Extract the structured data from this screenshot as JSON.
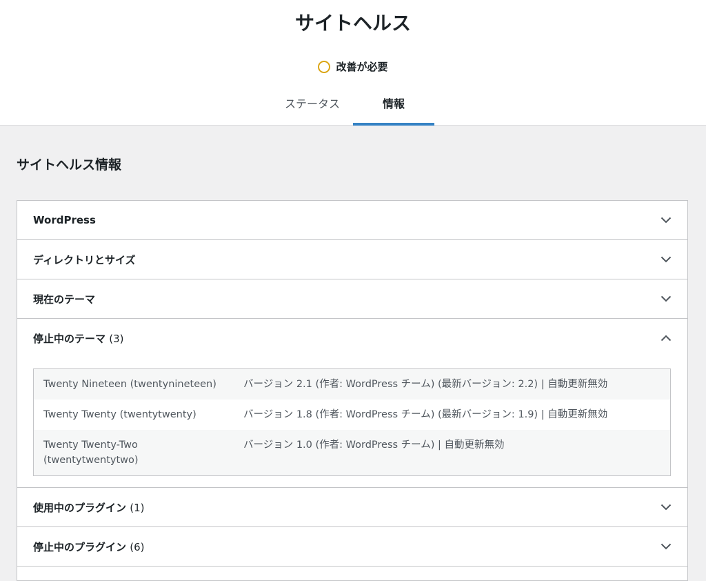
{
  "header": {
    "title": "サイトヘルス",
    "status_label": "改善が必要",
    "tabs": [
      {
        "label": "ステータス",
        "active": false
      },
      {
        "label": "情報",
        "active": true
      }
    ]
  },
  "section": {
    "title": "サイトヘルス情報"
  },
  "accordion": [
    {
      "label": "WordPress",
      "count": "",
      "expanded": false
    },
    {
      "label": "ディレクトリとサイズ",
      "count": "",
      "expanded": false
    },
    {
      "label": "現在のテーマ",
      "count": "",
      "expanded": false
    },
    {
      "label": "停止中のテーマ",
      "count": "(3)",
      "expanded": true
    },
    {
      "label": "使用中のプラグイン",
      "count": "(1)",
      "expanded": false
    },
    {
      "label": "停止中のプラグイン",
      "count": "(6)",
      "expanded": false
    }
  ],
  "inactive_themes": [
    {
      "name": "Twenty Nineteen (twentynineteen)",
      "value": "バージョン 2.1 (作者: WordPress チーム) (最新バージョン: 2.2) | 自動更新無効"
    },
    {
      "name": "Twenty Twenty (twentytwenty)",
      "value": "バージョン 1.8 (作者: WordPress チーム) (最新バージョン: 1.9) | 自動更新無効"
    },
    {
      "name": "Twenty Twenty-Two (twentytwentytwo)",
      "value": "バージョン 1.0 (作者: WordPress チーム) | 自動更新無効"
    }
  ],
  "colors": {
    "status_ring": "#dba617",
    "active_tab_underline": "#3582c4"
  },
  "icons": {
    "collapsed": "chevron-down-icon",
    "expanded": "chevron-up-icon",
    "status": "status-ring-icon"
  }
}
